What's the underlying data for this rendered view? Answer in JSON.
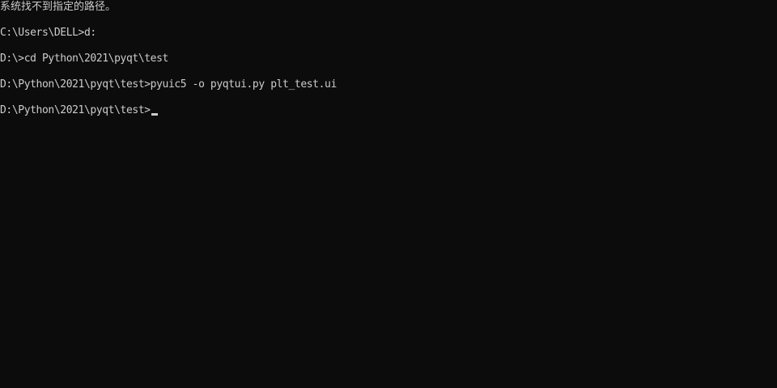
{
  "console": {
    "lines": [
      "系统找不到指定的路径。",
      "C:\\Users\\DELL>d:",
      "D:\\>cd Python\\2021\\pyqt\\test",
      "D:\\Python\\2021\\pyqt\\test>pyuic5 -o pyqtui.py plt_test.ui",
      "D:\\Python\\2021\\pyqt\\test>"
    ]
  },
  "colors": {
    "background": "#0c0c0c",
    "foreground": "#cccccc"
  }
}
